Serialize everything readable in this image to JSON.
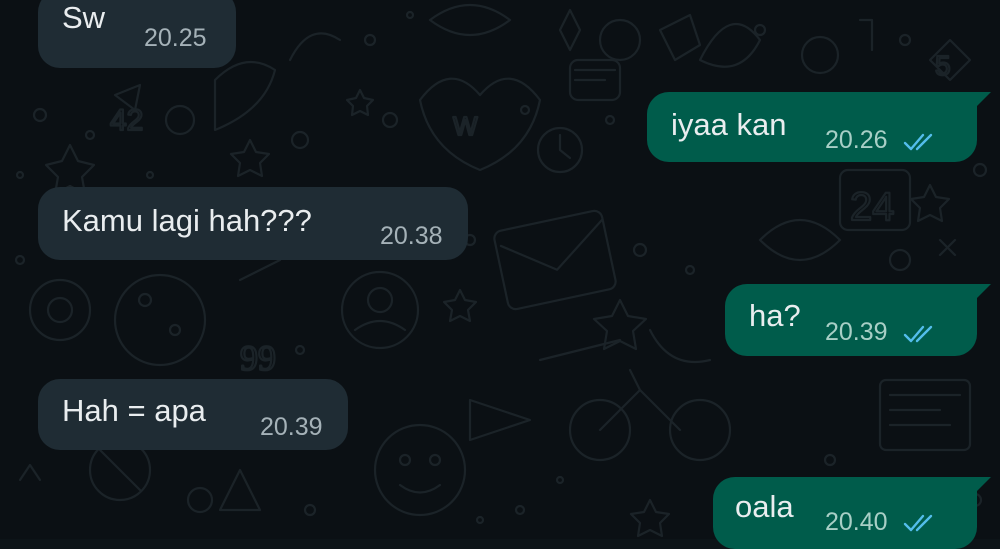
{
  "chat": {
    "messages": [
      {
        "direction": "incoming",
        "text": "Sw",
        "time": "20.25"
      },
      {
        "direction": "outgoing",
        "text": "iyaa kan",
        "time": "20.26",
        "status": "read-double-check-icon"
      },
      {
        "direction": "incoming",
        "text": "Kamu lagi hah???",
        "time": "20.38"
      },
      {
        "direction": "outgoing",
        "text": "ha?",
        "time": "20.39",
        "status": "read-double-check-icon"
      },
      {
        "direction": "incoming",
        "text": "Hah = apa",
        "time": "20.39"
      },
      {
        "direction": "outgoing",
        "text": "oala",
        "time": "20.40",
        "status": "read-double-check-icon"
      }
    ]
  },
  "theme": {
    "background": "#0b1014",
    "incoming_bubble": "#1f2c34",
    "outgoing_bubble": "#005c4b",
    "read_tick_color": "#53bdeb"
  }
}
